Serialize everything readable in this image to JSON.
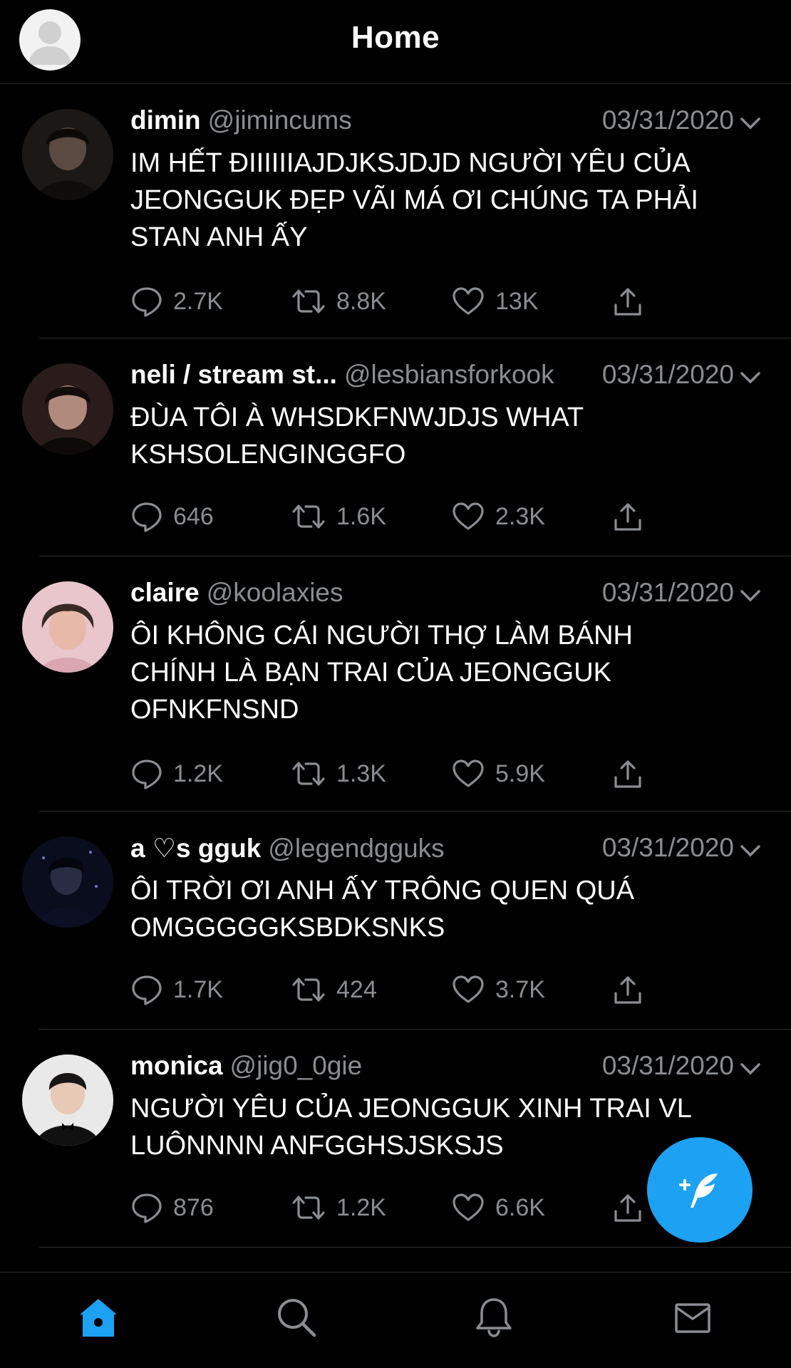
{
  "header": {
    "title": "Home"
  },
  "tweets": [
    {
      "name": "dimin",
      "handle": "@jimincums",
      "date": "03/31/2020",
      "text": "IM HẾT ĐIIIIIIAJDJKSJDJD NGƯỜI YÊU CỦA\nJEONGGUK ĐẸP VÃI MÁ ƠI CHÚNG TA PHẢI\nSTAN ANH ẤY",
      "replies": "2.7K",
      "retweets": "8.8K",
      "likes": "13K"
    },
    {
      "name": "neli / stream st...",
      "handle": "@lesbiansforkook",
      "date": "03/31/2020",
      "text": "ĐÙA TÔI À WHSDKFNWJDJS WHAT\nKSHSOLENGINGGFO",
      "replies": "646",
      "retweets": "1.6K",
      "likes": "2.3K"
    },
    {
      "name": "claire",
      "handle": "@koolaxies",
      "date": "03/31/2020",
      "text": "ÔI KHÔNG CÁI NGƯỜI THỢ LÀM BÁNH\nCHÍNH LÀ BẠN TRAI CỦA JEONGGUK\nOFNKFNSND",
      "replies": "1.2K",
      "retweets": "1.3K",
      "likes": "5.9K"
    },
    {
      "name": "a ♡s gguk",
      "handle": "@legendgguks",
      "date": "03/31/2020",
      "text": "ÔI TRỜI ƠI ANH ẤY TRÔNG QUEN QUÁ\nOMGGGGGKSBDKSNKS",
      "replies": "1.7K",
      "retweets": "424",
      "likes": "3.7K"
    },
    {
      "name": "monica",
      "handle": "@jig0_0gie",
      "date": "03/31/2020",
      "text": "NGƯỜI YÊU CỦA JEONGGUK XINH TRAI VL\nLUÔNNNN ANFGGHSJSKSJS",
      "replies": "876",
      "retweets": "1.2K",
      "likes": "6.6K"
    }
  ],
  "icons": {
    "reply": "speech-bubble-icon",
    "retweet": "retweet-icon",
    "like": "heart-icon",
    "share": "share-icon",
    "compose": "compose-quill-icon",
    "home": "home-icon",
    "search": "search-icon",
    "notifications": "bell-icon",
    "messages": "mail-icon"
  },
  "colors": {
    "accent": "#1da1f2",
    "muted": "#8a8d91",
    "background": "#000000"
  }
}
